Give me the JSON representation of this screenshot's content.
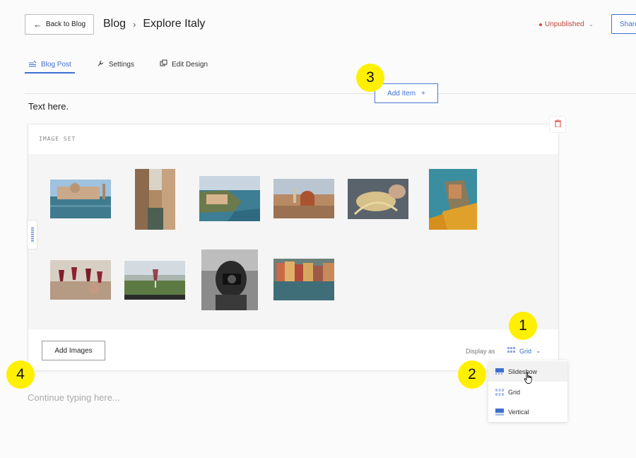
{
  "header": {
    "back_label": "Back to Blog",
    "breadcrumb": [
      "Blog",
      "Explore Italy"
    ],
    "breadcrumb_separator": "›",
    "status": "Unpublished",
    "share_label": "Share"
  },
  "tabs": [
    {
      "label": "Blog Post",
      "icon": "blog-post-icon",
      "active": true
    },
    {
      "label": "Settings",
      "icon": "wrench-icon",
      "active": false
    },
    {
      "label": "Edit Design",
      "icon": "layers-icon",
      "active": false
    }
  ],
  "add_item_label": "Add Item",
  "add_item_symbol": "+",
  "intro_text": "Text here.",
  "image_set": {
    "label": "IMAGE SET",
    "photos": [
      "venice-canal",
      "venice-narrow-canal",
      "cinque-terre-coast",
      "florence-duomo",
      "pasta-making",
      "vernazza-cliff",
      "wine-toast",
      "vineyard-wine-glass",
      "photographer-bw",
      "riomaggiore-harbor"
    ],
    "add_images_label": "Add Images",
    "display_as_label": "Display as",
    "display_value": "Grid"
  },
  "display_options": [
    {
      "label": "Slideshow",
      "icon": "slideshow-icon",
      "hovered": true
    },
    {
      "label": "Grid",
      "icon": "grid-icon",
      "hovered": false
    },
    {
      "label": "Vertical",
      "icon": "vertical-icon",
      "hovered": false
    }
  ],
  "continue_placeholder": "Continue typing here...",
  "annotations": [
    "1",
    "2",
    "3",
    "4"
  ],
  "colors": {
    "accent": "#3f6fd1",
    "status_red": "#d9473c",
    "badge_yellow": "#fff000"
  }
}
